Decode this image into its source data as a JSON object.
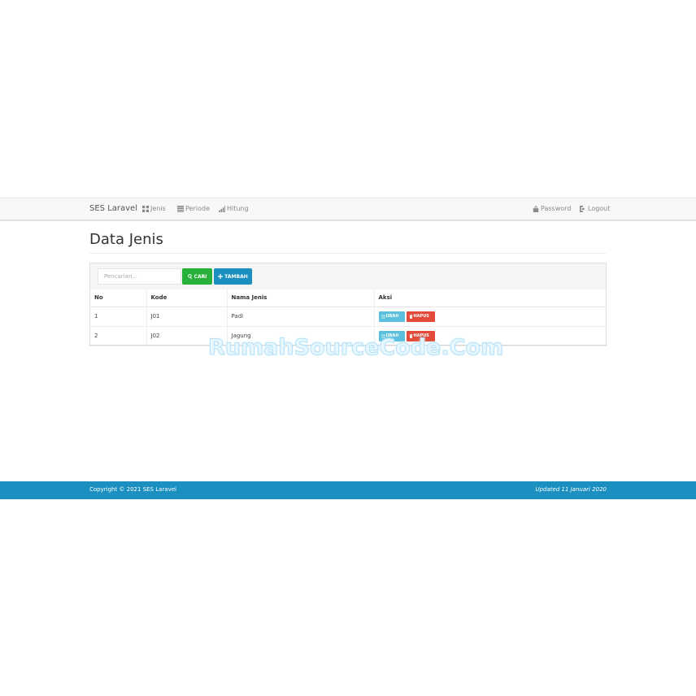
{
  "navbar": {
    "brand": "SES Laravel",
    "links": [
      {
        "label": "Jenis",
        "icon": "grid-icon"
      },
      {
        "label": "Periode",
        "icon": "table-icon"
      },
      {
        "label": "Hitung",
        "icon": "signal-icon"
      }
    ],
    "right_links": [
      {
        "label": "Password",
        "icon": "lock-icon"
      },
      {
        "label": "Logout",
        "icon": "logout-icon"
      }
    ]
  },
  "page": {
    "title": "Data Jenis"
  },
  "toolbar": {
    "search_placeholder": "Pencarian...",
    "search_value": "",
    "cari_label": "CARI",
    "tambah_label": "TAMBAH"
  },
  "table": {
    "headers": [
      "No",
      "Kode",
      "Nama Jenis",
      "Aksi"
    ],
    "rows": [
      {
        "no": "1",
        "kode": "J01",
        "nama": "Padi"
      },
      {
        "no": "2",
        "kode": "J02",
        "nama": "Jagung"
      }
    ],
    "ubah_label": "UBAH",
    "hapus_label": "HAPUS"
  },
  "watermark": "RumahSourceCode.Com",
  "footer": {
    "copyright": "Copyright © 2021 SES Laravel",
    "updated": "Updated 11 Januari 2020"
  },
  "colors": {
    "primary": "#1a8fc0",
    "success": "#27b03a",
    "info": "#5bc0de",
    "danger": "#e24b3a"
  }
}
